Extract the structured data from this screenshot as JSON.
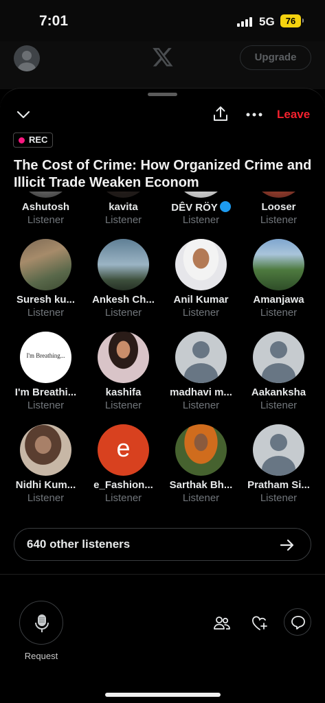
{
  "status_bar": {
    "time": "7:01",
    "network": "5G",
    "battery": "76"
  },
  "top_bar": {
    "upgrade_label": "Upgrade"
  },
  "header": {
    "leave_label": "Leave",
    "rec_label": "REC"
  },
  "space": {
    "title": "The Cost of Crime: How Organized Crime and Illicit Trade Weaken Econom"
  },
  "participants": [
    {
      "name": "Ashutosh",
      "role": "Listener",
      "avatar": "photo-bw"
    },
    {
      "name": "kavita",
      "role": "Listener",
      "avatar": "photo-dark"
    },
    {
      "name": "DÊV RÖY",
      "role": "Listener",
      "avatar": "photo-light",
      "verified": true
    },
    {
      "name": "Looser",
      "role": "Listener",
      "avatar": "photo-red"
    },
    {
      "name": "Suresh ku...",
      "role": "Listener",
      "avatar": "photo-nature"
    },
    {
      "name": "Ankesh Ch...",
      "role": "Listener",
      "avatar": "photo-sky"
    },
    {
      "name": "Anil Kumar",
      "role": "Listener",
      "avatar": "photo-portrait"
    },
    {
      "name": "Amanjawa",
      "role": "Listener",
      "avatar": "photo-garden"
    },
    {
      "name": "I'm Breathi...",
      "role": "Listener",
      "avatar": "text-logo",
      "avatar_text": "I'm Breathing..."
    },
    {
      "name": "kashifa",
      "role": "Listener",
      "avatar": "photo-woman"
    },
    {
      "name": "madhavi m...",
      "role": "Listener",
      "avatar": "default"
    },
    {
      "name": "Aakanksha",
      "role": "Listener",
      "avatar": "default"
    },
    {
      "name": "Nidhi Kum...",
      "role": "Listener",
      "avatar": "photo-woman2"
    },
    {
      "name": "e_Fashion...",
      "role": "Listener",
      "avatar": "letter",
      "avatar_letter": "e"
    },
    {
      "name": "Sarthak Bh...",
      "role": "Listener",
      "avatar": "photo-man"
    },
    {
      "name": "Pratham Si...",
      "role": "Listener",
      "avatar": "default"
    }
  ],
  "other_listeners": {
    "label": "640 other listeners"
  },
  "footer": {
    "request_label": "Request"
  },
  "colors": {
    "leave": "#f4212e",
    "rec_dot": "#f91880",
    "accent": "#1d9bf0",
    "letter_avatar": "#d8411f"
  }
}
